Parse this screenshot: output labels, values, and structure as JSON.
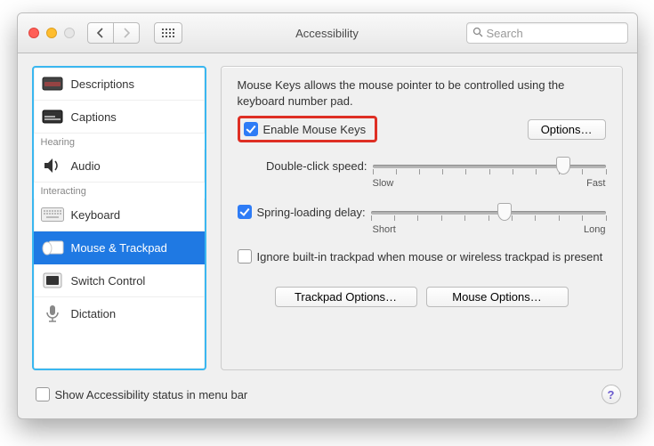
{
  "window": {
    "title": "Accessibility"
  },
  "toolbar": {
    "search_placeholder": "Search"
  },
  "sidebar": {
    "items": [
      {
        "label": "Descriptions",
        "icon": "descriptions-icon"
      },
      {
        "label": "Captions",
        "icon": "captions-icon"
      }
    ],
    "hearing_label": "Hearing",
    "hearing_items": [
      {
        "label": "Audio",
        "icon": "audio-icon"
      }
    ],
    "interacting_label": "Interacting",
    "interacting_items": [
      {
        "label": "Keyboard",
        "icon": "keyboard-icon"
      },
      {
        "label": "Mouse & Trackpad",
        "icon": "mouse-trackpad-icon",
        "selected": true
      },
      {
        "label": "Switch Control",
        "icon": "switch-control-icon"
      },
      {
        "label": "Dictation",
        "icon": "dictation-icon"
      }
    ]
  },
  "main": {
    "description": "Mouse Keys allows the mouse pointer to be controlled using the keyboard number pad.",
    "enable_mouse_keys_label": "Enable Mouse Keys",
    "enable_mouse_keys_checked": true,
    "options_button": "Options…",
    "double_click_label": "Double-click speed:",
    "double_click_min": "Slow",
    "double_click_max": "Fast",
    "double_click_value_pct": 82,
    "spring_loading_label": "Spring-loading delay:",
    "spring_loading_checked": true,
    "spring_loading_min": "Short",
    "spring_loading_max": "Long",
    "spring_loading_value_pct": 57,
    "ignore_trackpad_label": "Ignore built-in trackpad when mouse or wireless trackpad is present",
    "ignore_trackpad_checked": false,
    "trackpad_options_button": "Trackpad Options…",
    "mouse_options_button": "Mouse Options…"
  },
  "footer": {
    "show_status_label": "Show Accessibility status in menu bar",
    "show_status_checked": false,
    "help_glyph": "?"
  },
  "tick_count": 11
}
